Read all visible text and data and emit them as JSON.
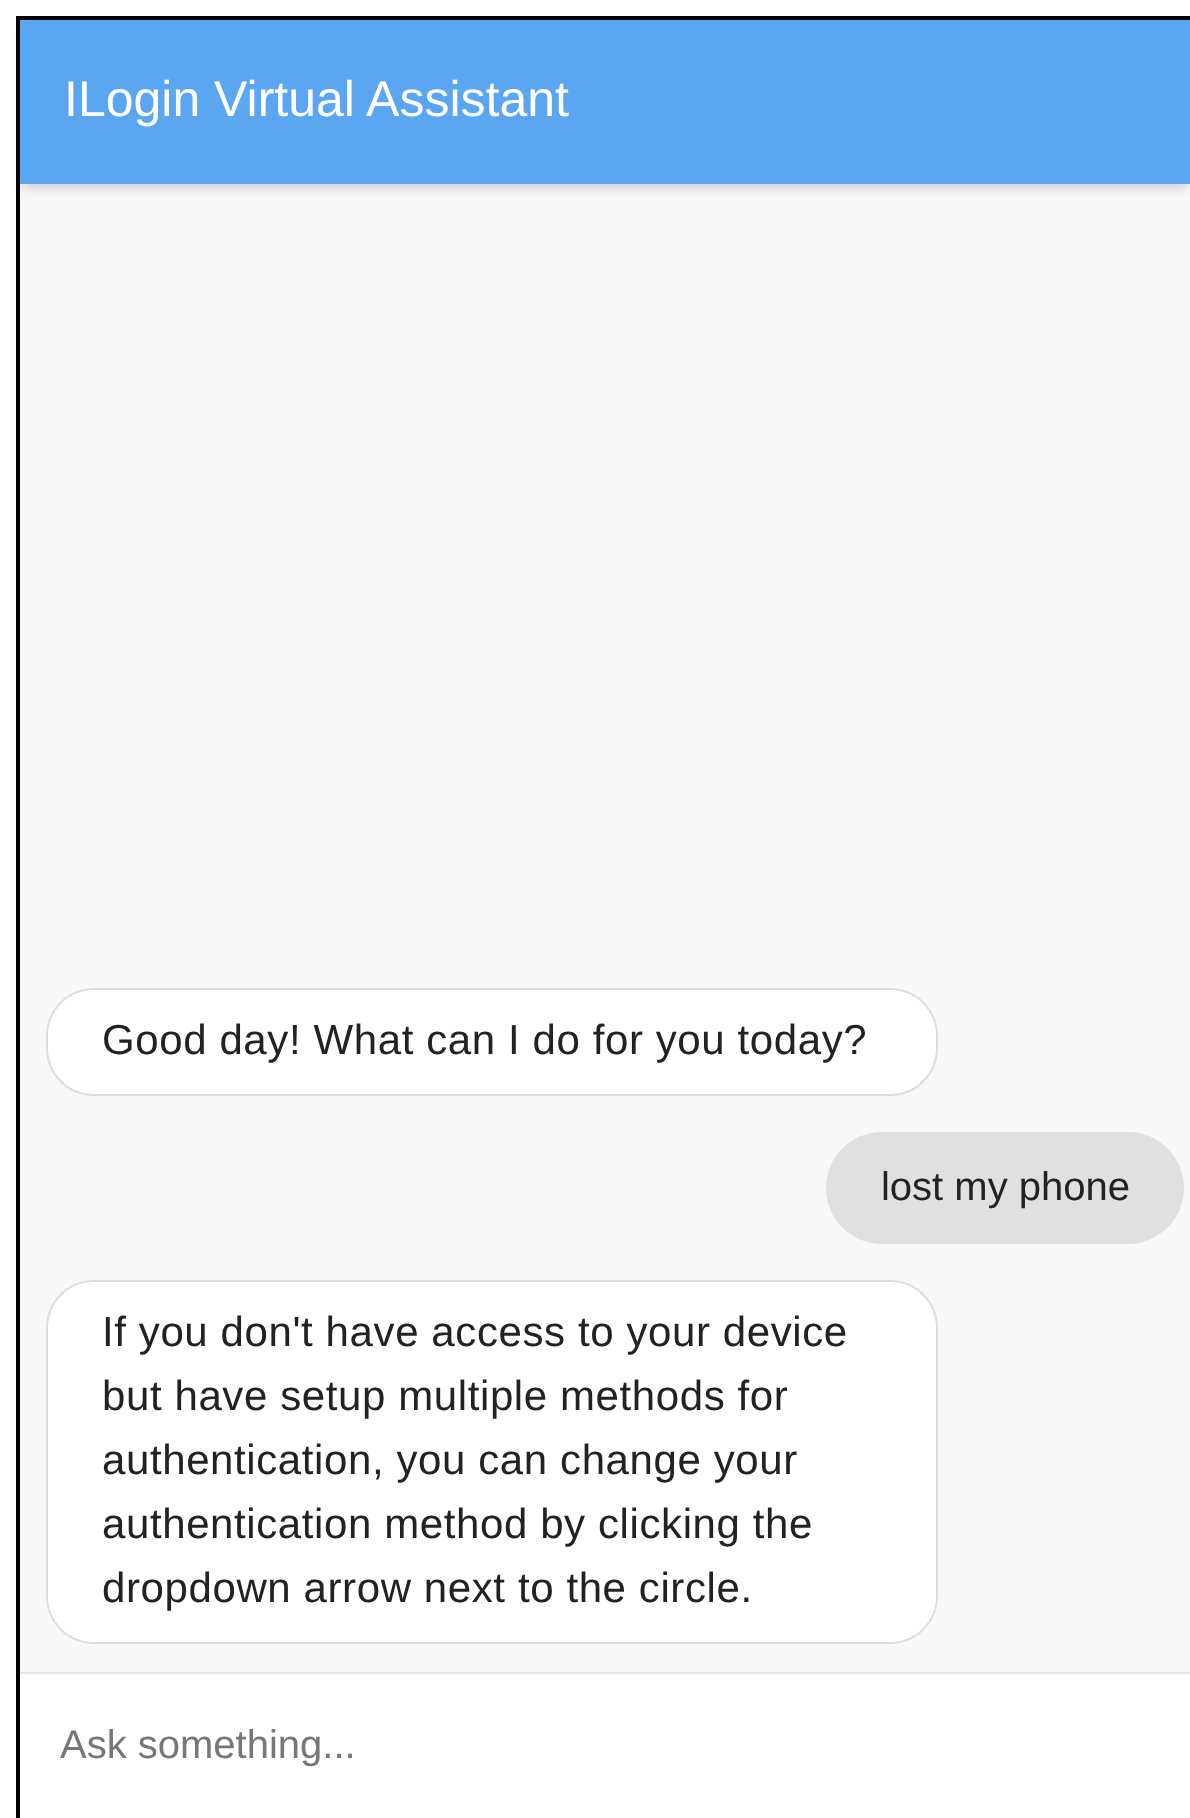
{
  "header": {
    "title": "ILogin Virtual Assistant"
  },
  "messages": [
    {
      "kind": "bot",
      "text": "Good day! What can I do for you today?"
    },
    {
      "kind": "user",
      "text": "lost my phone"
    },
    {
      "kind": "bot",
      "text": "If you don't have access to your device but have setup multiple methods for authentication, you can change your authentication method by clicking the dropdown arrow next to the circle."
    }
  ],
  "input": {
    "placeholder": "Ask something..."
  }
}
